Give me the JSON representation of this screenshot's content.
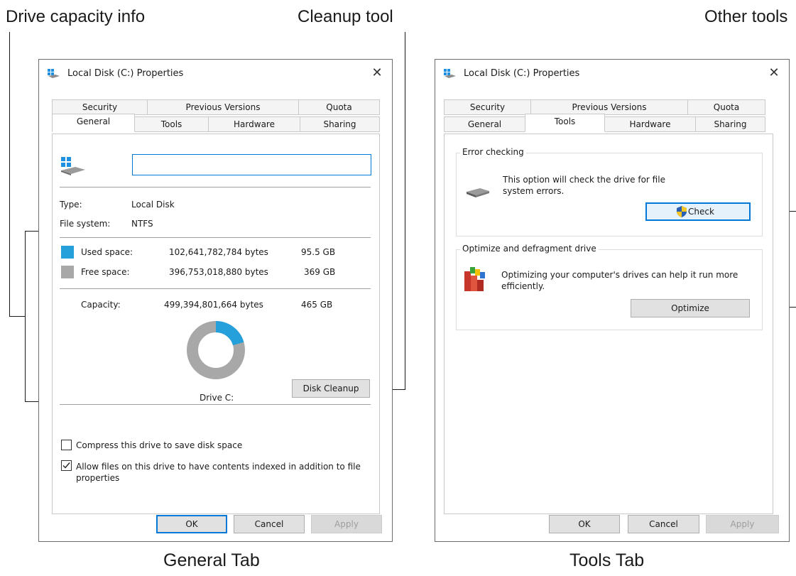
{
  "callouts": {
    "drive_capacity": "Drive capacity info",
    "cleanup": "Cleanup tool",
    "other_tools": "Other tools"
  },
  "captions": {
    "general": "General Tab",
    "tools": "Tools Tab"
  },
  "dialog": {
    "title": "Local Disk (C:) Properties",
    "close_icon": "close-icon",
    "tabs_back": [
      "Security",
      "Previous Versions",
      "Quota"
    ],
    "tabs_front": [
      "General",
      "Tools",
      "Hardware",
      "Sharing"
    ],
    "ok": "OK",
    "cancel": "Cancel",
    "apply": "Apply"
  },
  "general": {
    "drive_name_value": "",
    "type_label": "Type:",
    "type_value": "Local Disk",
    "fs_label": "File system:",
    "fs_value": "NTFS",
    "used_label": "Used space:",
    "used_bytes": "102,641,782,784 bytes",
    "used_gb": "95.5 GB",
    "free_label": "Free space:",
    "free_bytes": "396,753,018,880 bytes",
    "free_gb": "369 GB",
    "capacity_label": "Capacity:",
    "capacity_bytes": "499,394,801,664 bytes",
    "capacity_gb": "465 GB",
    "drive_label": "Drive C:",
    "disk_cleanup": "Disk Cleanup",
    "compress_label": "Compress this drive to save disk space",
    "compress_checked": false,
    "index_label": "Allow files on this drive to have contents indexed in addition to file properties",
    "index_checked": true,
    "used_fraction": 0.205,
    "colors": {
      "used": "#26a0da",
      "free": "#a8a8a8"
    }
  },
  "tools": {
    "error_group": "Error checking",
    "error_desc": "This option will check the drive for file system errors.",
    "check": "Check",
    "optimize_group": "Optimize and defragment drive",
    "optimize_desc": "Optimizing your computer's drives can help it run more efficiently.",
    "optimize": "Optimize"
  }
}
